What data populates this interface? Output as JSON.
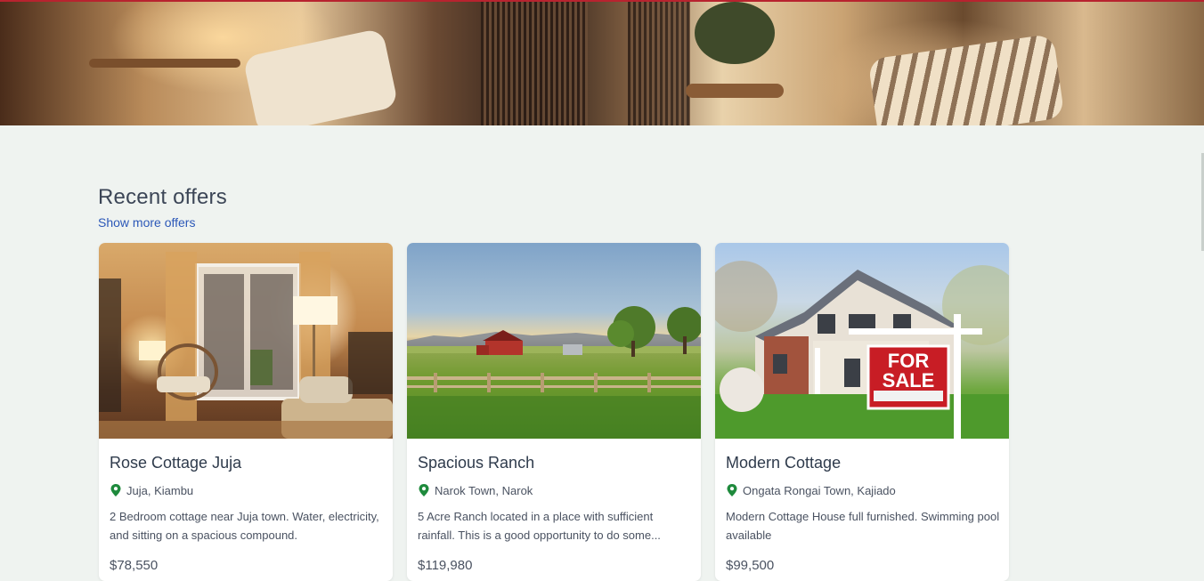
{
  "section": {
    "title": "Recent offers",
    "show_more": "Show more offers"
  },
  "offers": [
    {
      "title": "Rose Cottage Juja",
      "location": "Juja, Kiambu",
      "description": "2 Bedroom cottage near Juja town. Water, electricity, and sitting on a spacious compound.",
      "price": "$78,550",
      "image": "cozy-living-room-photo"
    },
    {
      "title": "Spacious Ranch",
      "location": "Narok Town, Narok",
      "description": "5 Acre Ranch located in a place with sufficient rainfall. This is a good opportunity to do some...",
      "price": "$119,980",
      "image": "ranch-field-barn-photo"
    },
    {
      "title": "Modern Cottage",
      "location": "Ongata Rongai Town, Kajiado",
      "description": "Modern Cottage House full furnished. Swimming pool available",
      "price": "$99,500",
      "image": "house-for-sale-photo",
      "sign_text": [
        "FOR",
        "SALE"
      ]
    }
  ],
  "colors": {
    "accent_link": "#2c58b8",
    "pin_green": "#1e8a3c",
    "page_bg": "#eff3f0",
    "hero_border": "#b8232f"
  }
}
